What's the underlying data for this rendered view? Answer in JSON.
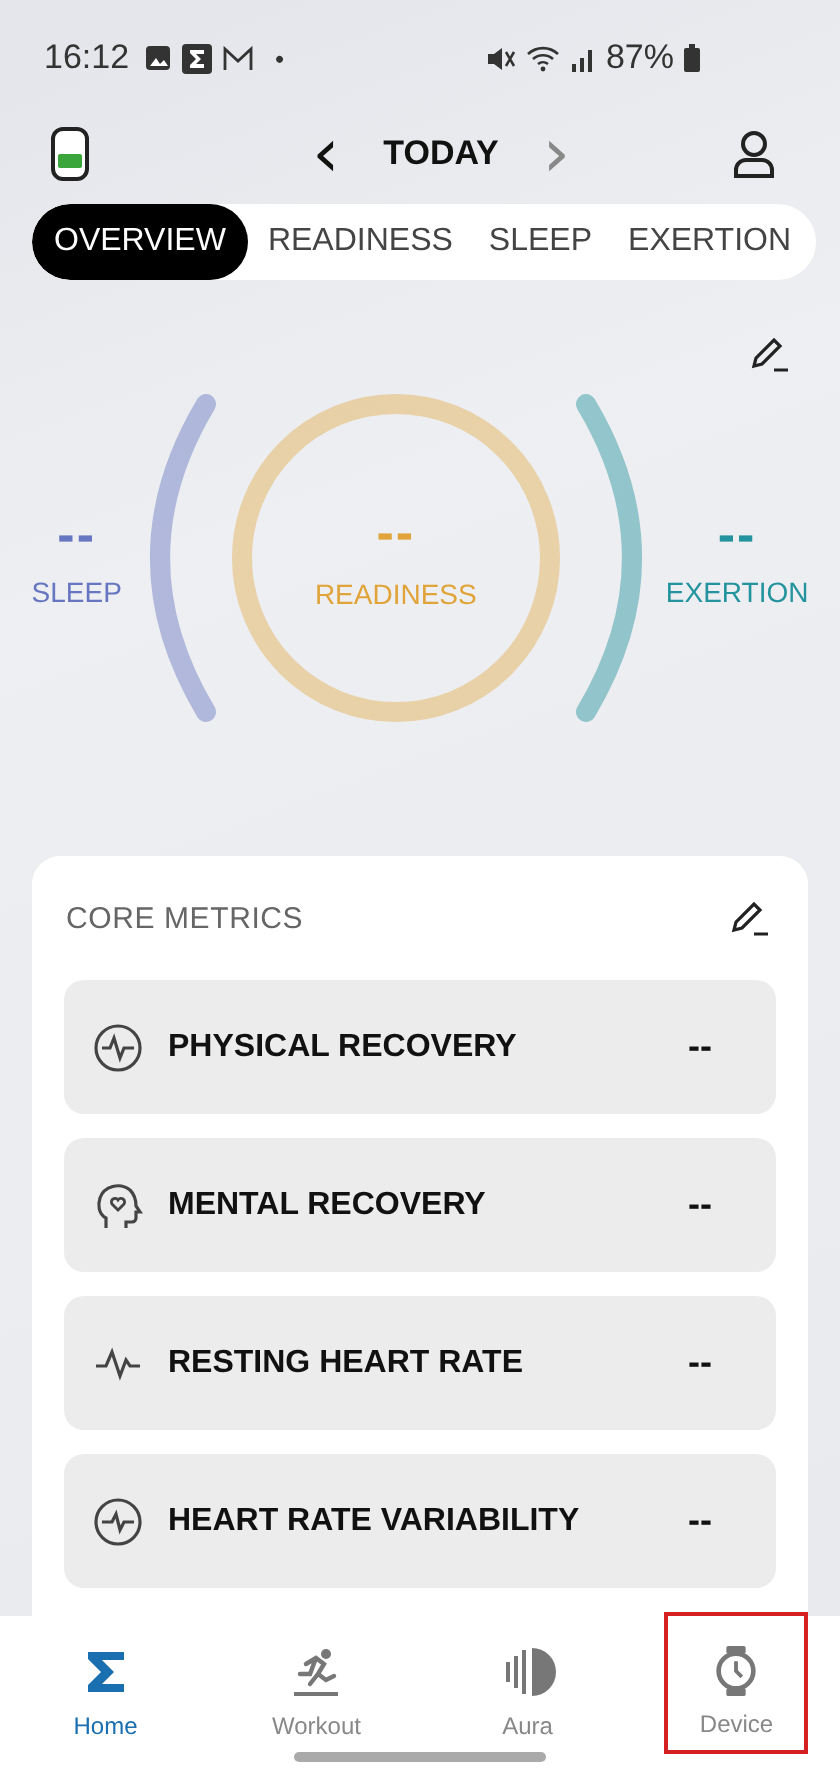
{
  "status_bar": {
    "time": "16:12",
    "dot": "•",
    "battery": "87%"
  },
  "header": {
    "title": "TODAY",
    "prev": "‹",
    "next": "›"
  },
  "tabs": [
    {
      "label": "OVERVIEW",
      "selected": true
    },
    {
      "label": "READINESS",
      "selected": false
    },
    {
      "label": "SLEEP",
      "selected": false
    },
    {
      "label": "EXERTION",
      "selected": false
    }
  ],
  "scores": [
    {
      "kind": "side",
      "label": "SLEEP",
      "value": "--",
      "color": "#6676c0"
    },
    {
      "kind": "center",
      "label": "READINESS",
      "value": "--",
      "color": "#e0a43a"
    },
    {
      "kind": "side",
      "label": "EXERTION",
      "value": "--",
      "color": "#23939e"
    }
  ],
  "core_metrics": {
    "title": "CORE METRICS",
    "items": [
      {
        "kind": "recovery",
        "label": "PHYSICAL RECOVERY",
        "value": "--"
      },
      {
        "kind": "mental",
        "label": "MENTAL RECOVERY",
        "value": "--"
      },
      {
        "kind": "rhr",
        "label": "RESTING HEART RATE",
        "value": "--"
      },
      {
        "kind": "hrv",
        "label": "HEART RATE VARIABILITY",
        "value": "--"
      }
    ]
  },
  "nav": [
    {
      "kind": "home",
      "label": "Home",
      "selected": true,
      "highlighted": false
    },
    {
      "kind": "workout",
      "label": "Workout",
      "selected": false,
      "highlighted": false
    },
    {
      "kind": "aura",
      "label": "Aura",
      "selected": false,
      "highlighted": false
    },
    {
      "kind": "device",
      "label": "Device",
      "selected": false,
      "highlighted": true
    }
  ]
}
